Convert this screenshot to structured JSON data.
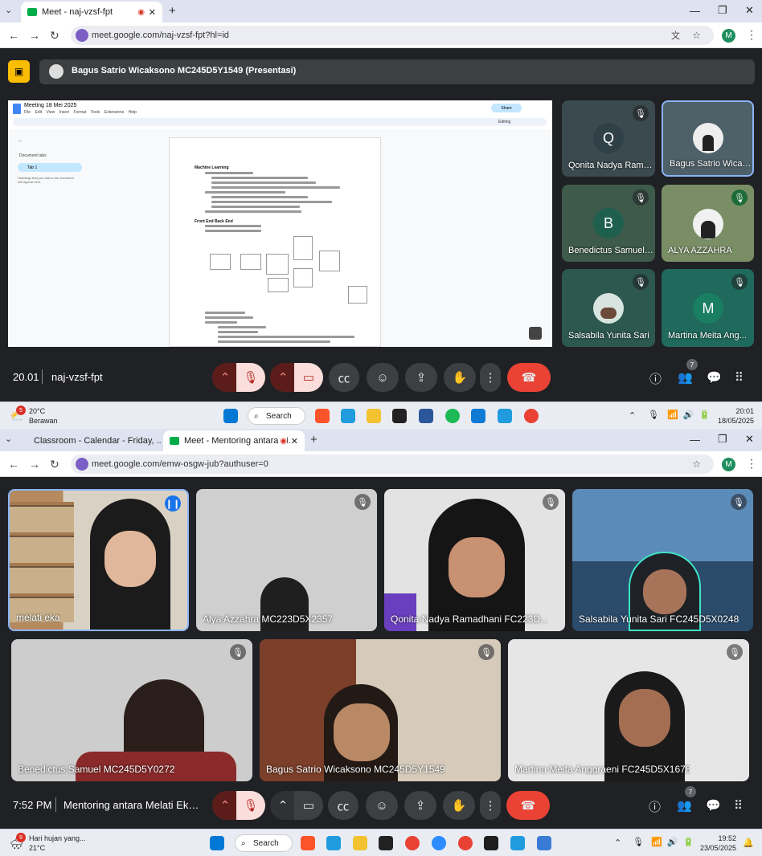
{
  "top_window": {
    "tabs": [
      {
        "label": "Meet - naj-vzsf-fpt",
        "recording": true
      }
    ],
    "url": "meet.google.com/naj-vzsf-fpt?hl=id",
    "presenter_banner": "Bagus Satrio Wicaksono MC245D5Y1549 (Presentasi)",
    "doc": {
      "title": "Meeting 18 Mei 2025",
      "menu": [
        "File",
        "Edit",
        "View",
        "Insert",
        "Format",
        "Tools",
        "Extensions",
        "Help"
      ],
      "share": "Share",
      "editing": "Editing",
      "sidebar_title": "Document tabs",
      "tab1": "Tab 1",
      "sidebar_hint": "Headings that you add to the document will appear here.",
      "heading1": "Machine Learning",
      "heading2": "Front End Back End"
    },
    "participants": [
      {
        "initial": "Q",
        "name": "Qonita Nadya Rama...",
        "muted": true
      },
      {
        "initial": "",
        "name": "Bagus Satrio Wicaks...",
        "muted": false
      },
      {
        "initial": "B",
        "name": "Benedictus Samuel ...",
        "muted": true
      },
      {
        "initial": "",
        "name": "ALYA AZZAHRA",
        "muted": true
      },
      {
        "initial": "",
        "name": "Salsabila Yunita Sari",
        "muted": true
      },
      {
        "initial": "M",
        "name": "Martina Meita Ang...",
        "muted": true
      }
    ],
    "time": "20.01",
    "code": "naj-vzsf-fpt",
    "people_count": "7"
  },
  "taskbar1": {
    "badge": "5",
    "temp": "20°C",
    "weather": "Berawan",
    "search": "Search",
    "time": "20:01",
    "date": "18/05/2025"
  },
  "bottom_window": {
    "tabs": [
      {
        "label": "Classroom - Calendar - Friday, ..."
      },
      {
        "label": "Meet - Mentoring antara M..."
      }
    ],
    "url": "meet.google.com/emw-osgw-jub?authuser=0",
    "participants": [
      {
        "name": "melati eka"
      },
      {
        "name": "Alya Azzahra MC223D5X2357"
      },
      {
        "name": "Qonita Nadya Ramadhani FC223D..."
      },
      {
        "name": "Salsabila Yunita Sari FC245D5X0248"
      },
      {
        "name": "Benedictus Samuel MC245D5Y0272"
      },
      {
        "name": "Bagus Satrio Wicaksono MC245D5Y1549"
      },
      {
        "name": "Martina Meita Anggraeni FC245D5X1678"
      }
    ],
    "time": "7:52 PM",
    "title": "Mentoring antara Melati Eka ...",
    "people_count": "7"
  },
  "taskbar2": {
    "badge": "9",
    "weather": "Hari hujan yang...",
    "temp": "21°C",
    "search": "Search",
    "time": "19:52",
    "date": "23/05/2025"
  },
  "profile_initial": "M"
}
